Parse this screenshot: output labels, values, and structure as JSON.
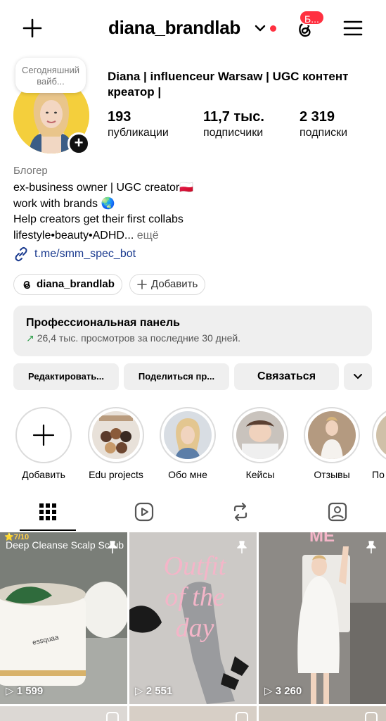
{
  "header": {
    "username": "diana_brandlab",
    "notifications_badge": "Б..."
  },
  "profile": {
    "note": "Сегодняшний вайб...",
    "full_name": "Diana | influenceur Warsaw  | UGC контент креатор |",
    "stats": [
      {
        "value": "193",
        "label": "публикации"
      },
      {
        "value": "11,7 тыс.",
        "label": "подписчики"
      },
      {
        "value": "2 319",
        "label": "подписки"
      }
    ],
    "category": "Блогер",
    "bio_lines": [
      "ex-business owner | UGC creator🇵🇱",
      "work with brands 🌏",
      "Help creators get their first collabs",
      "lifestyle•beauty•ADHD..."
    ],
    "bio_more": "ещё",
    "link": "t.me/smm_spec_bot",
    "threads_chip": "diana_brandlab",
    "add_chip": "Добавить"
  },
  "dashboard": {
    "title": "Профессиональная панель",
    "subtitle": "26,4 тыс. просмотров за последние 30 дней."
  },
  "actions": {
    "edit": "Редактировать...",
    "share": "Поделиться пр...",
    "contact": "Связаться"
  },
  "highlights": [
    {
      "label": "Добавить"
    },
    {
      "label": "Edu projects"
    },
    {
      "label": "Обо мне"
    },
    {
      "label": "Кейсы"
    },
    {
      "label": "Отзывы"
    },
    {
      "label": "По"
    }
  ],
  "posts": [
    {
      "views": "1 599",
      "overlay_title": "Deep Cleanse Scalp Scrub",
      "rating": "⭐7/10",
      "brand": "essquaa"
    },
    {
      "views": "2 551",
      "overlay_title": "Outfit of the day"
    },
    {
      "views": "3 260",
      "overlay_title": "ME"
    }
  ],
  "colors": {
    "accent_red": "#ff3040",
    "link_blue": "#1b3b8f",
    "growth_green": "#2e9d4a",
    "button_bg": "#efefef"
  }
}
